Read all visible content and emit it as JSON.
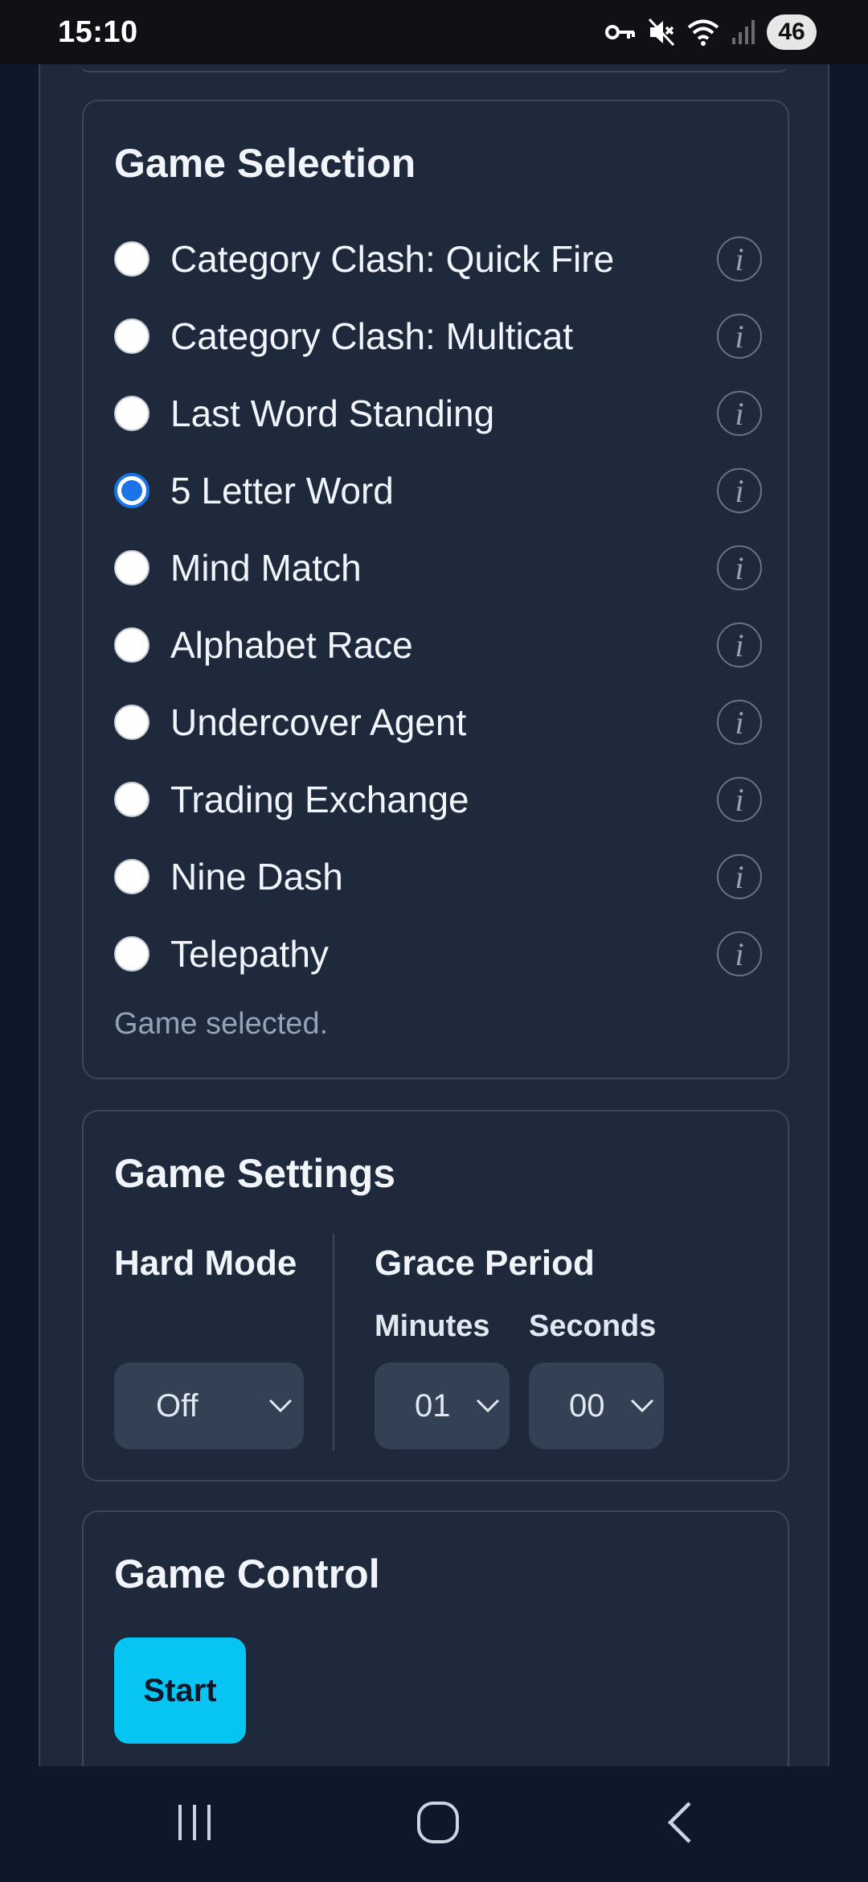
{
  "status_bar": {
    "time": "15:10",
    "battery": "46",
    "icons": [
      "vpn-key-icon",
      "mute-icon",
      "wifi-icon",
      "signal-icon"
    ]
  },
  "game_selection": {
    "title": "Game Selection",
    "games": [
      {
        "label": "Category Clash: Quick Fire",
        "selected": false
      },
      {
        "label": "Category Clash: Multicat",
        "selected": false
      },
      {
        "label": "Last Word Standing",
        "selected": false
      },
      {
        "label": "5 Letter Word",
        "selected": true
      },
      {
        "label": "Mind Match",
        "selected": false
      },
      {
        "label": "Alphabet Race",
        "selected": false
      },
      {
        "label": "Undercover Agent",
        "selected": false
      },
      {
        "label": "Trading Exchange",
        "selected": false
      },
      {
        "label": "Nine Dash",
        "selected": false
      },
      {
        "label": "Telepathy",
        "selected": false
      }
    ],
    "info_glyph": "i",
    "status": "Game selected."
  },
  "game_settings": {
    "title": "Game Settings",
    "hard_mode": {
      "label": "Hard Mode",
      "value": "Off"
    },
    "grace_period": {
      "label": "Grace Period",
      "minutes_label": "Minutes",
      "minutes_value": "01",
      "seconds_label": "Seconds",
      "seconds_value": "00"
    }
  },
  "game_control": {
    "title": "Game Control",
    "start_label": "Start"
  },
  "colors": {
    "background": "#0f172a",
    "card": "#1e293b",
    "accent": "#06c5f3",
    "radio_selected": "#1a73e8"
  },
  "nav_bar": {
    "icons": [
      "recent-apps-icon",
      "home-icon",
      "back-icon"
    ]
  }
}
